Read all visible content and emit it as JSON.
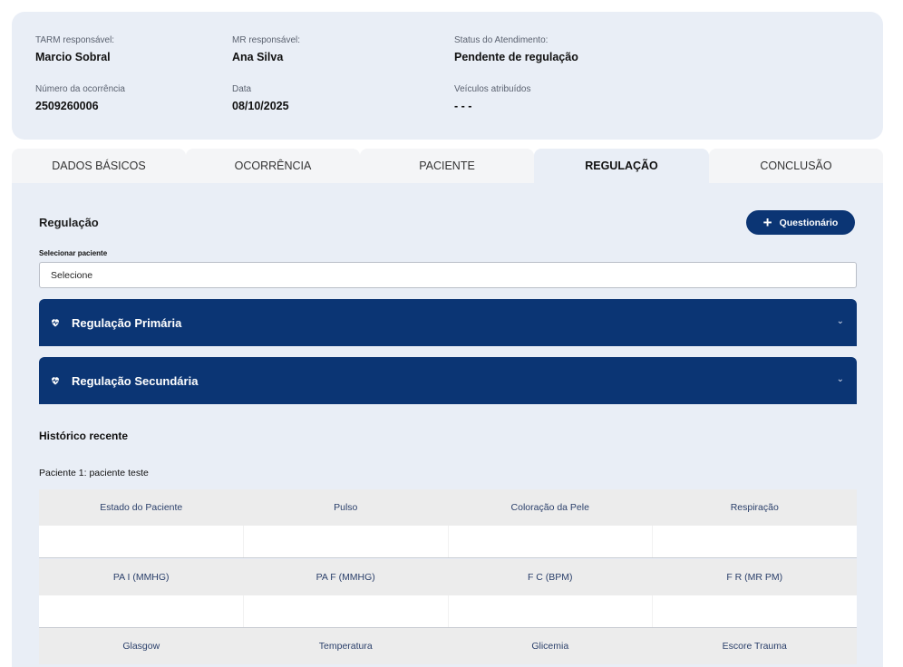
{
  "header": {
    "tarm_label": "TARM responsável:",
    "tarm_value": "Marcio Sobral",
    "mr_label": "MR responsável:",
    "mr_value": "Ana Silva",
    "status_label": "Status do Atendimento:",
    "status_value": "Pendente de regulação",
    "occ_label": "Número da ocorrência",
    "occ_value": "2509260006",
    "date_label": "Data",
    "date_value": "08/10/2025",
    "vehicles_label": "Veículos atribuídos",
    "vehicles_value": "- - -"
  },
  "tabs": [
    {
      "label": "DADOS BÁSICOS"
    },
    {
      "label": "OCORRÊNCIA"
    },
    {
      "label": "PACIENTE"
    },
    {
      "label": "REGULAÇÃO"
    },
    {
      "label": "CONCLUSÃO"
    }
  ],
  "active_tab": "REGULAÇÃO",
  "regulation": {
    "title": "Regulação",
    "questionnaire_button": "Questionário",
    "select_label": "Selecionar paciente",
    "select_value": "Selecione",
    "accordions": [
      {
        "title": "Regulação Primária",
        "icon": "heart-pulse-icon"
      },
      {
        "title": "Regulação Secundária",
        "icon": "heart-pulse-icon"
      }
    ]
  },
  "history": {
    "title": "Histórico recente",
    "patient_label": "Paciente 1: paciente teste",
    "rows": [
      [
        "Estado do Paciente",
        "Pulso",
        "Coloração da Pele",
        "Respiração"
      ],
      [
        "PA I (MMHG)",
        "PA F (MMHG)",
        "F C (BPM)",
        "F R (MR PM)"
      ],
      [
        "Glasgow",
        "Temperatura",
        "Glicemia",
        "Escore Trauma"
      ]
    ]
  },
  "colors": {
    "primary": "#0b3574",
    "panel": "#e9eef6"
  }
}
